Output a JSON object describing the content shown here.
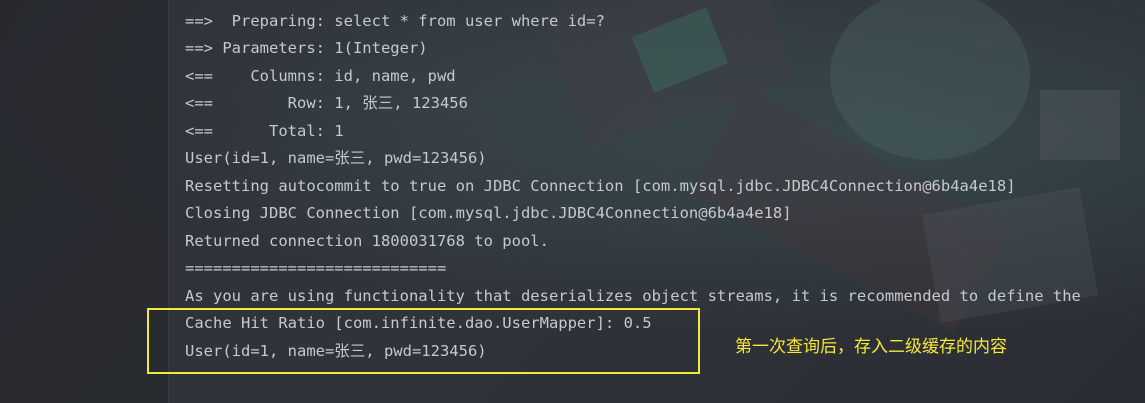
{
  "console": {
    "lines": [
      "==>  Preparing: select * from user where id=?",
      "==> Parameters: 1(Integer)",
      "<==    Columns: id, name, pwd",
      "<==        Row: 1, 张三, 123456",
      "<==      Total: 1",
      "User(id=1, name=张三, pwd=123456)",
      "Resetting autocommit to true on JDBC Connection [com.mysql.jdbc.JDBC4Connection@6b4a4e18]",
      "Closing JDBC Connection [com.mysql.jdbc.JDBC4Connection@6b4a4e18]",
      "Returned connection 1800031768 to pool.",
      "============================",
      "As you are using functionality that deserializes object streams, it is recommended to define the",
      "Cache Hit Ratio [com.infinite.dao.UserMapper]: 0.5",
      "User(id=1, name=张三, pwd=123456)"
    ]
  },
  "annotation": {
    "note": "第一次查询后，存入二级缓存的内容",
    "color": "#f5e83a"
  },
  "colors": {
    "console_text": "#c6c9ce",
    "background": "#2b2d33"
  }
}
